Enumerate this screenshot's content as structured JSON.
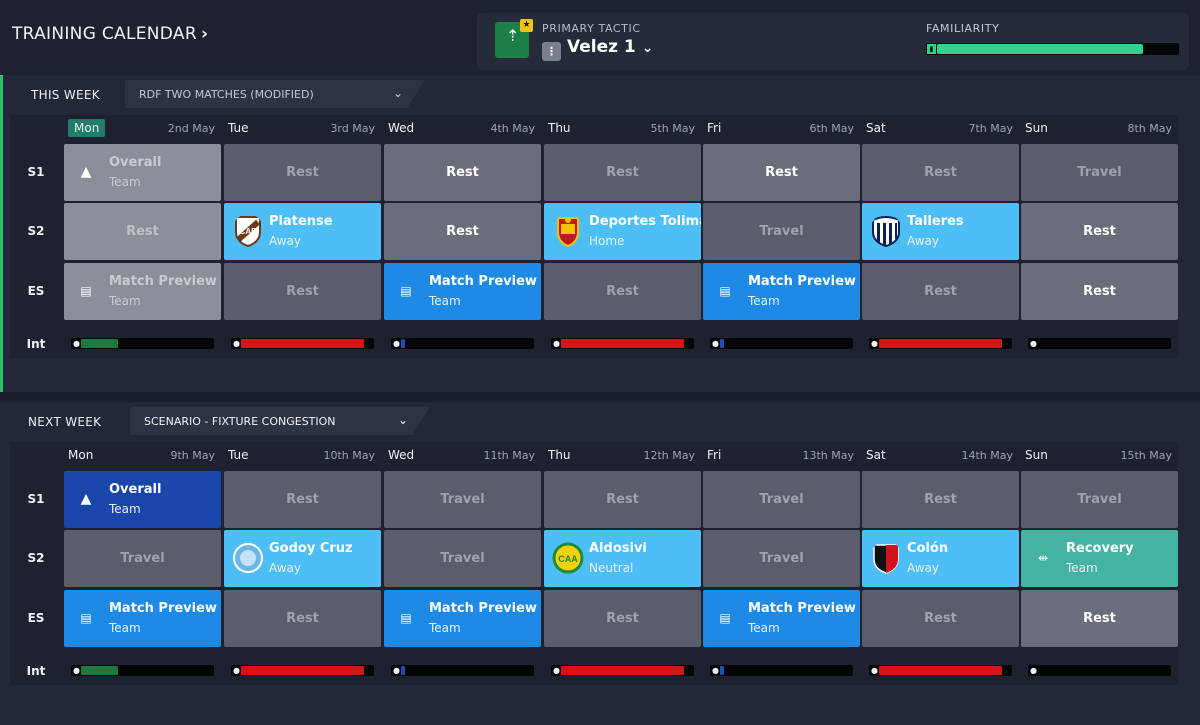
{
  "header": {
    "title": "TRAINING CALENDAR",
    "title_chevron": "›",
    "primary_tactic_label": "PRIMARY TACTIC",
    "tactic_name": "Velez 1",
    "tactic_chevron": "⌄",
    "familiarity_label": "FAMILIARITY",
    "familiarity_level": 0.86
  },
  "weeks": [
    {
      "label": "THIS WEEK",
      "schedule": "RDF TWO MATCHES (MODIFIED)",
      "days": [
        {
          "name": "Mon",
          "date": "2nd May",
          "today": true
        },
        {
          "name": "Tue",
          "date": "3rd May"
        },
        {
          "name": "Wed",
          "date": "4th May"
        },
        {
          "name": "Thu",
          "date": "5th May"
        },
        {
          "name": "Fri",
          "date": "6th May"
        },
        {
          "name": "Sat",
          "date": "7th May"
        },
        {
          "name": "Sun",
          "date": "8th May"
        }
      ],
      "rows": [
        {
          "label": "S1",
          "cells": [
            {
              "style": "dim",
              "title": "Overall",
              "sub": "Team",
              "icon": "cone-icon"
            },
            {
              "style": "rest",
              "text": "Rest",
              "tone": "muted"
            },
            {
              "style": "rest-light",
              "text": "Rest",
              "tone": "bright"
            },
            {
              "style": "rest",
              "text": "Rest",
              "tone": "muted"
            },
            {
              "style": "rest-light",
              "text": "Rest",
              "tone": "bright"
            },
            {
              "style": "rest",
              "text": "Rest",
              "tone": "muted"
            },
            {
              "style": "rest",
              "text": "Travel",
              "tone": "muted"
            }
          ]
        },
        {
          "label": "S2",
          "cells": [
            {
              "style": "dim",
              "text": "Rest",
              "tone": "dimtxt"
            },
            {
              "style": "lightblue",
              "title": "Platense",
              "sub": "Away",
              "crest": "platense"
            },
            {
              "style": "rest-light",
              "text": "Rest",
              "tone": "bright"
            },
            {
              "style": "lightblue",
              "title": "Deportes Tolima",
              "sub": "Home",
              "crest": "tolima"
            },
            {
              "style": "rest",
              "text": "Travel",
              "tone": "muted"
            },
            {
              "style": "lightblue",
              "title": "Talleres",
              "sub": "Away",
              "crest": "talleres"
            },
            {
              "style": "rest-light",
              "text": "Rest",
              "tone": "bright"
            }
          ]
        },
        {
          "label": "ES",
          "cells": [
            {
              "style": "dim",
              "title": "Match Preview",
              "sub": "Team",
              "icon": "document-icon"
            },
            {
              "style": "rest",
              "text": "Rest",
              "tone": "muted"
            },
            {
              "style": "blue",
              "title": "Match Preview",
              "sub": "Team",
              "icon": "document-icon"
            },
            {
              "style": "rest",
              "text": "Rest",
              "tone": "muted"
            },
            {
              "style": "blue",
              "title": "Match Preview",
              "sub": "Team",
              "icon": "document-icon"
            },
            {
              "style": "rest",
              "text": "Rest",
              "tone": "muted"
            },
            {
              "style": "rest-light",
              "text": "Rest",
              "tone": "bright"
            }
          ]
        }
      ],
      "intensity_label": "Int",
      "intensity": [
        {
          "level": 0.28,
          "color": "#1b7a3c"
        },
        {
          "level": 0.94,
          "color": "#d61414"
        },
        {
          "level": 0.03,
          "color": "#1f4fae"
        },
        {
          "level": 0.94,
          "color": "#d61414"
        },
        {
          "level": 0.03,
          "color": "#1f4fae"
        },
        {
          "level": 0.94,
          "color": "#d61414"
        },
        {
          "level": 0.0,
          "color": "#1f4fae"
        }
      ]
    },
    {
      "label": "NEXT WEEK",
      "schedule": "SCENARIO - FIXTURE CONGESTION",
      "days": [
        {
          "name": "Mon",
          "date": "9th May"
        },
        {
          "name": "Tue",
          "date": "10th May"
        },
        {
          "name": "Wed",
          "date": "11th May"
        },
        {
          "name": "Thu",
          "date": "12th May"
        },
        {
          "name": "Fri",
          "date": "13th May"
        },
        {
          "name": "Sat",
          "date": "14th May"
        },
        {
          "name": "Sun",
          "date": "15th May"
        }
      ],
      "rows": [
        {
          "label": "S1",
          "cells": [
            {
              "style": "navy",
              "title": "Overall",
              "sub": "Team",
              "icon": "cone-icon"
            },
            {
              "style": "rest",
              "text": "Rest",
              "tone": "muted"
            },
            {
              "style": "rest",
              "text": "Travel",
              "tone": "muted"
            },
            {
              "style": "rest",
              "text": "Rest",
              "tone": "muted"
            },
            {
              "style": "rest",
              "text": "Travel",
              "tone": "muted"
            },
            {
              "style": "rest",
              "text": "Rest",
              "tone": "muted"
            },
            {
              "style": "rest",
              "text": "Travel",
              "tone": "muted"
            }
          ]
        },
        {
          "label": "S2",
          "cells": [
            {
              "style": "rest",
              "text": "Travel",
              "tone": "muted"
            },
            {
              "style": "lightblue",
              "title": "Godoy Cruz",
              "sub": "Away",
              "crest": "godoy"
            },
            {
              "style": "rest",
              "text": "Travel",
              "tone": "muted"
            },
            {
              "style": "lightblue",
              "title": "Aldosivi",
              "sub": "Neutral",
              "crest": "aldosivi"
            },
            {
              "style": "rest",
              "text": "Travel",
              "tone": "muted"
            },
            {
              "style": "lightblue",
              "title": "Colón",
              "sub": "Away",
              "crest": "colon"
            },
            {
              "style": "teal",
              "title": "Recovery",
              "sub": "Team",
              "icon": "recovery-icon"
            }
          ]
        },
        {
          "label": "ES",
          "cells": [
            {
              "style": "blue",
              "title": "Match Preview",
              "sub": "Team",
              "icon": "document-icon"
            },
            {
              "style": "rest",
              "text": "Rest",
              "tone": "muted"
            },
            {
              "style": "blue",
              "title": "Match Preview",
              "sub": "Team",
              "icon": "document-icon"
            },
            {
              "style": "rest",
              "text": "Rest",
              "tone": "muted"
            },
            {
              "style": "blue",
              "title": "Match Preview",
              "sub": "Team",
              "icon": "document-icon"
            },
            {
              "style": "rest",
              "text": "Rest",
              "tone": "muted"
            },
            {
              "style": "rest-light",
              "text": "Rest",
              "tone": "bright"
            }
          ]
        }
      ],
      "intensity_label": "Int",
      "intensity": [
        {
          "level": 0.28,
          "color": "#1b7a3c"
        },
        {
          "level": 0.94,
          "color": "#d61414"
        },
        {
          "level": 0.03,
          "color": "#1f4fae"
        },
        {
          "level": 0.94,
          "color": "#d61414"
        },
        {
          "level": 0.03,
          "color": "#1f4fae"
        },
        {
          "level": 0.94,
          "color": "#d61414"
        },
        {
          "level": 0.0,
          "color": "#1f4fae"
        }
      ]
    }
  ]
}
